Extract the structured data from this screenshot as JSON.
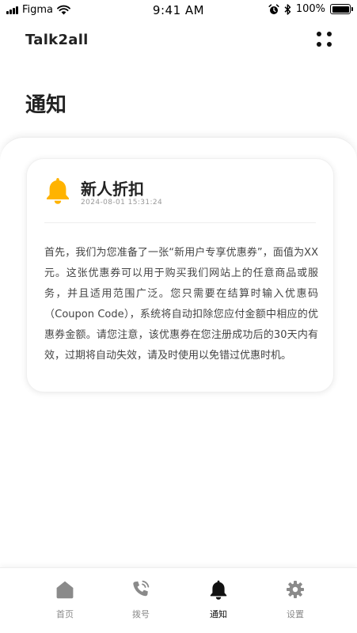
{
  "status_bar": {
    "carrier": "Figma",
    "time": "9:41 AM",
    "battery": "100%",
    "icons": [
      "signal-icon",
      "wifi-icon",
      "alarm-icon",
      "bluetooth-icon",
      "battery-icon"
    ]
  },
  "header": {
    "logo": "Talk2all",
    "menu_icon": "four-dots-menu-icon"
  },
  "page": {
    "title": "通知"
  },
  "notification": {
    "icon": "bell-icon",
    "icon_color": "#FFB300",
    "title": "新人折扣",
    "time": "2024-08-01 15:31:24",
    "body": "首先，我们为您准备了一张“新用户专享优惠券”，面值为XX元。这张优惠券可以用于购买我们网站上的任意商品或服务，并且适用范围广泛。您只需要在结算时输入优惠码（Coupon Code），系统将自动扣除您应付金额中相应的优惠券金额。请您注意，该优惠券在您注册成功后的30天内有效，过期将自动失效，请及时使用以免错过优惠时机。"
  },
  "tabs": [
    {
      "label": "首页",
      "icon": "home-icon",
      "active": false
    },
    {
      "label": "拨号",
      "icon": "phone-dial-icon",
      "active": false
    },
    {
      "label": "通知",
      "icon": "bell-icon",
      "active": true
    },
    {
      "label": "设置",
      "icon": "gear-icon",
      "active": false
    }
  ],
  "colors": {
    "active_tab": "#111111",
    "inactive_tab": "#8A8A8A",
    "accent": "#FFB300"
  }
}
